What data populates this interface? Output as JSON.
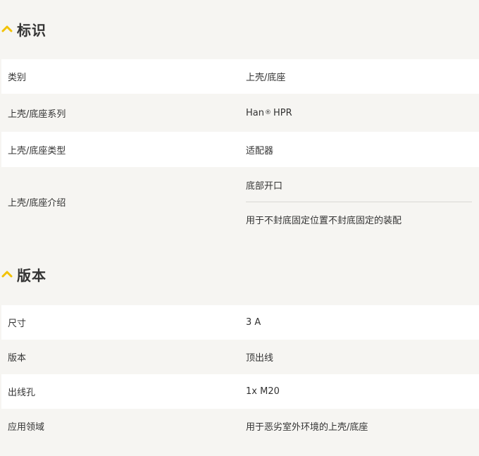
{
  "sections": [
    {
      "title": "标识",
      "rows": [
        {
          "label": "类别",
          "value": "上壳/底座"
        },
        {
          "label": "上壳/底座系列",
          "value_main": "Han",
          "value_sup": "®",
          "value_tail": "HPR"
        },
        {
          "label": "上壳/底座类型",
          "value": "适配器"
        },
        {
          "label": "上壳/底座介绍",
          "values": [
            "底部开口",
            "用于不封底固定位置不封底固定的装配"
          ]
        }
      ]
    },
    {
      "title": "版本",
      "rows": [
        {
          "label": "尺寸",
          "value": "3 A"
        },
        {
          "label": "版本",
          "value": "顶出线"
        },
        {
          "label": "出线孔",
          "value": "1x M20"
        },
        {
          "label": "应用领域",
          "value": "用于恶劣室外环境的上壳/底座"
        }
      ]
    }
  ],
  "colors": {
    "accent": "#f2c200",
    "row_white": "#ffffff",
    "row_grey": "#f6f5f2",
    "text": "#333333"
  },
  "icons": {
    "section_toggle": "chevron-up-icon"
  }
}
